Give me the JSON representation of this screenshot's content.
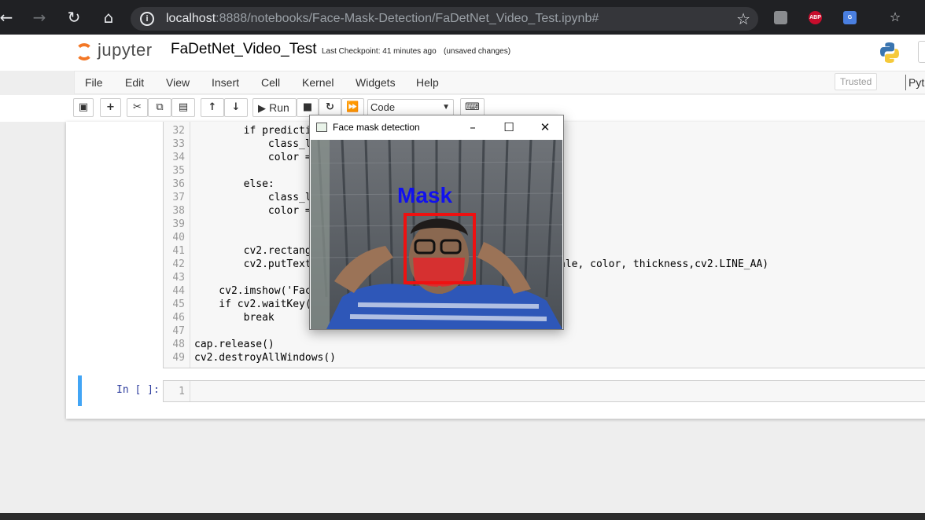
{
  "browser": {
    "url_host": "localhost",
    "url_rest": ":8888/notebooks/Face-Mask-Detection/FaDetNet_Video_Test.ipynb#",
    "extensions": [
      {
        "name": "abp",
        "label": "ABP",
        "color": "#c70d2c"
      },
      {
        "name": "translate",
        "label": "G",
        "color": "#4a7fe0"
      }
    ]
  },
  "header": {
    "logo_text": "jupyter",
    "notebook_title": "FaDetNet_Video_Test",
    "checkpoint": "Last Checkpoint: 41 minutes ago",
    "autosave": "(unsaved changes)"
  },
  "menubar": {
    "items": [
      "File",
      "Edit",
      "View",
      "Insert",
      "Cell",
      "Kernel",
      "Widgets",
      "Help"
    ],
    "trusted": "Trusted",
    "kernel": "Pyth"
  },
  "toolbar": {
    "run_label": "Run",
    "cell_type": "Code"
  },
  "code_cell": {
    "lines": [
      {
        "n": "32",
        "text": "        if predicti"
      },
      {
        "n": "33",
        "text": "            class_l"
      },
      {
        "n": "34",
        "text": "            color ="
      },
      {
        "n": "35",
        "text": ""
      },
      {
        "n": "36",
        "text": "        else:"
      },
      {
        "n": "37",
        "text": "            class_l"
      },
      {
        "n": "38",
        "text": "            color ="
      },
      {
        "n": "39",
        "text": ""
      },
      {
        "n": "40",
        "text": ""
      },
      {
        "n": "41",
        "text": "        cv2.rectang"
      },
      {
        "n": "42",
        "text": "        cv2.putText"
      },
      {
        "n": "43",
        "text": ""
      },
      {
        "n": "44",
        "text": "    cv2.imshow('Fac"
      },
      {
        "n": "45",
        "text": "    if cv2.waitKey("
      },
      {
        "n": "46",
        "text": "        break"
      },
      {
        "n": "47",
        "text": ""
      },
      {
        "n": "48",
        "text": "cap.release()"
      },
      {
        "n": "49",
        "text": "cv2.destroyAllWindows()"
      }
    ],
    "line42_tail": "ale, color, thickness,cv2.LINE_AA)"
  },
  "empty_cell": {
    "prompt": "In [ ]:",
    "line_number": "1"
  },
  "cv_window": {
    "title": "Face mask detection",
    "detection_label": "Mask",
    "label_color": "#1111ee",
    "box_color": "#ee1111"
  },
  "colors": {
    "jupyter_orange": "#f37726",
    "cell_selected": "#42a5f5",
    "prompt_blue": "#303f9f"
  }
}
